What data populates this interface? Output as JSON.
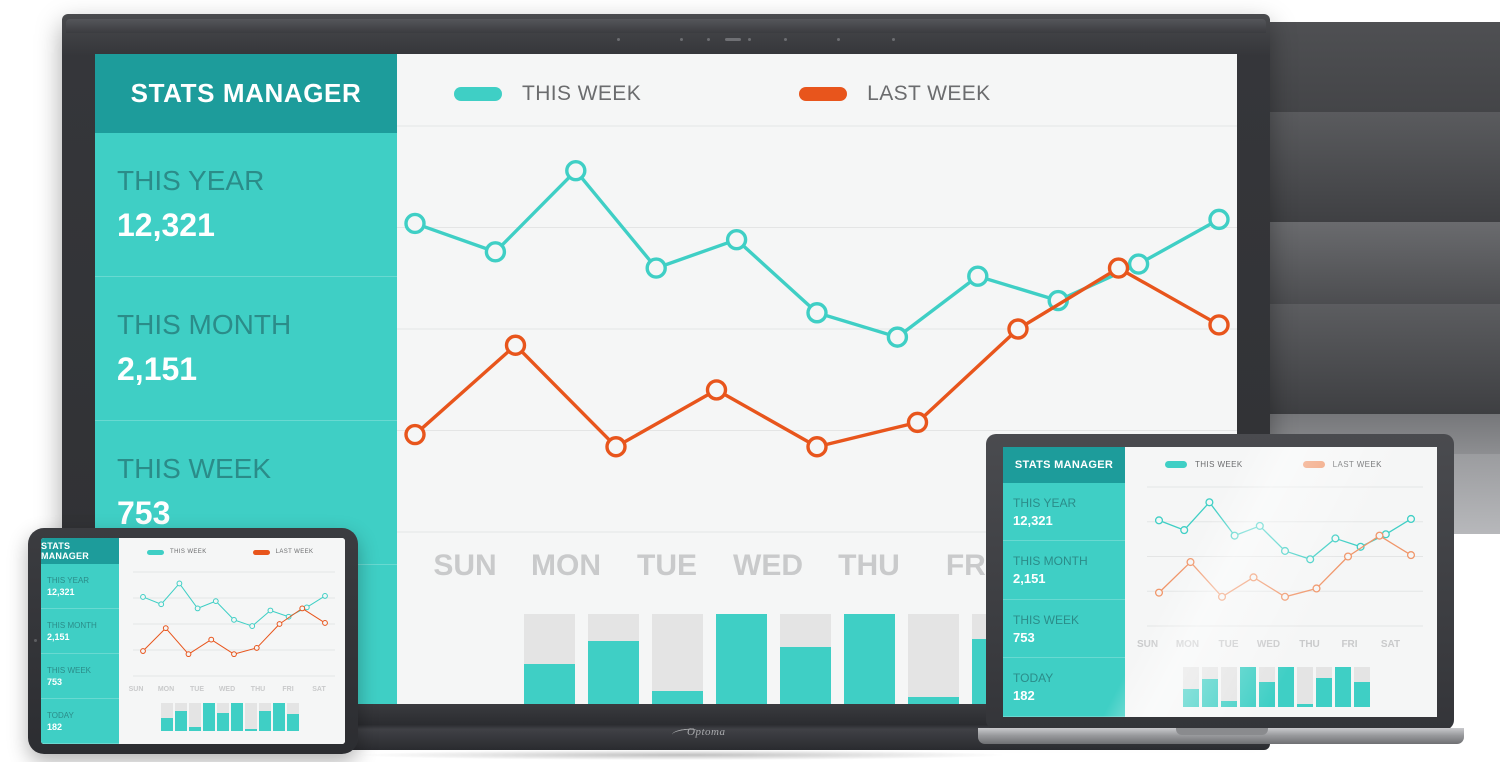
{
  "app": {
    "title": "STATS MANAGER",
    "brand": "Optoma",
    "accent_teal": "#3fcfc5",
    "accent_teal_dark": "#1d9c9b",
    "accent_orange": "#e8551c",
    "accent_orange_light": "#f0966a",
    "screen_bg": "#f5f6f6",
    "bar_track": "#e4e4e4",
    "gridline": "#e4e5e5",
    "daylabel_color": "#c9cacb"
  },
  "sidebar": {
    "header": "STATS MANAGER",
    "stats": [
      {
        "label": "THIS YEAR",
        "value": "12,321"
      },
      {
        "label": "THIS MONTH",
        "value": "2,151"
      },
      {
        "label": "THIS WEEK",
        "value": "753"
      },
      {
        "label": "TODAY",
        "value": "182"
      }
    ]
  },
  "legend": [
    {
      "label": "THIS WEEK",
      "color": "#3fcfc5"
    },
    {
      "label": "LAST  WEEK",
      "color": "#e8551c"
    }
  ],
  "chart_data": {
    "type": "line",
    "title": "",
    "xlabel": "",
    "ylabel": "",
    "categories": [
      "SUN",
      "MON",
      "TUE",
      "WED",
      "THU",
      "FRI",
      "SAT"
    ],
    "x_points": [
      0,
      3.5,
      7,
      10.5,
      14,
      17.5,
      21,
      24.5,
      28,
      31.5,
      35,
      38.5,
      42,
      45.5
    ],
    "ylim": [
      0,
      100
    ],
    "grid": true,
    "gridline_values": [
      100,
      75,
      50,
      25,
      0
    ],
    "legend_position": "top",
    "series": [
      {
        "name": "THIS WEEK",
        "color": "#3fcfc5",
        "values": [
          76,
          69,
          89,
          65,
          72,
          54,
          48,
          63,
          57,
          66,
          77
        ]
      },
      {
        "name": "LAST WEEK",
        "color": "#e8551c",
        "values": [
          24,
          46,
          21,
          35,
          21,
          27,
          50,
          65,
          51
        ]
      }
    ],
    "bars": {
      "type": "bar",
      "track_color": "#e4e4e4",
      "fill_color": "#3fcfc5",
      "fill_percent": [
        45,
        70,
        15,
        100,
        63,
        100,
        8,
        72,
        100,
        62
      ]
    }
  },
  "devices": {
    "display_label": "interactive-flat-panel",
    "laptop_label": "laptop",
    "tablet_label": "tablet"
  }
}
